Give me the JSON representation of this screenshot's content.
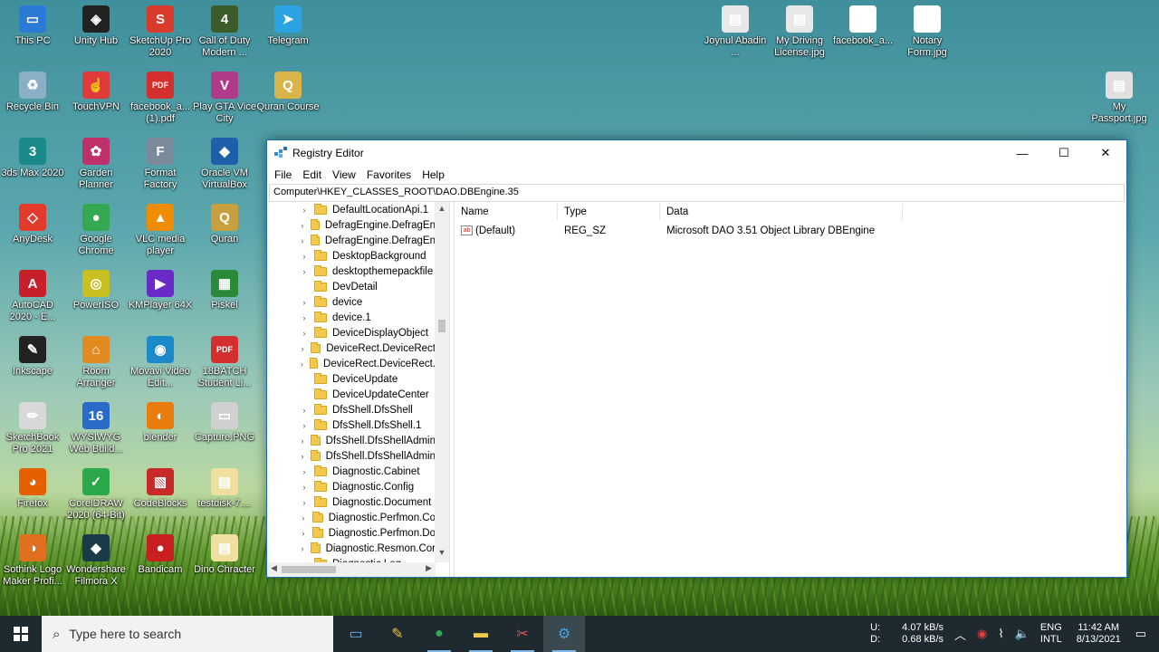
{
  "desktop_icons": [
    {
      "label": "This PC",
      "color": "#2b7bd6",
      "glyph": "▭"
    },
    {
      "label": "Unity Hub",
      "color": "#222222",
      "glyph": "◈"
    },
    {
      "label": "SketchUp Pro 2020",
      "color": "#d83b2b",
      "glyph": "S"
    },
    {
      "label": "Call of Duty Modern ...",
      "color": "#3b5b2b",
      "glyph": "4"
    },
    {
      "label": "Telegram",
      "color": "#2aa3e0",
      "glyph": "➤"
    },
    {
      "label": "Recycle Bin",
      "color": "#8ab0c8",
      "glyph": "♻"
    },
    {
      "label": "TouchVPN",
      "color": "#e03a3a",
      "glyph": "☝"
    },
    {
      "label": "facebook_a... (1).pdf",
      "color": "#d32f2f",
      "glyph": "PDF"
    },
    {
      "label": "Play GTA Vice City",
      "color": "#b03a8a",
      "glyph": "V"
    },
    {
      "label": "Quran Course",
      "color": "#d9b44a",
      "glyph": "Q"
    },
    {
      "label": "3ds Max 2020",
      "color": "#1a8a8a",
      "glyph": "3"
    },
    {
      "label": "Garden Planner",
      "color": "#c0306a",
      "glyph": "✿"
    },
    {
      "label": "Format Factory",
      "color": "#7a8a9a",
      "glyph": "F"
    },
    {
      "label": "Oracle VM VirtualBox",
      "color": "#1d5fa8",
      "glyph": "◆"
    },
    {
      "label": "AnyDesk",
      "color": "#e23b2e",
      "glyph": "◇"
    },
    {
      "label": "Google Chrome",
      "color": "#34a853",
      "glyph": "●"
    },
    {
      "label": "VLC media player",
      "color": "#f08c00",
      "glyph": "▲"
    },
    {
      "label": "Quran",
      "color": "#c8a040",
      "glyph": "Q"
    },
    {
      "label": "AutoCAD 2020 - E...",
      "color": "#c8202a",
      "glyph": "A"
    },
    {
      "label": "PowerISO",
      "color": "#c8c020",
      "glyph": "◎"
    },
    {
      "label": "KMPlayer 64X",
      "color": "#6a2ac8",
      "glyph": "▶"
    },
    {
      "label": "Piskel",
      "color": "#2a8a3a",
      "glyph": "▦"
    },
    {
      "label": "Inkscape",
      "color": "#222222",
      "glyph": "✎"
    },
    {
      "label": "Room Arranger",
      "color": "#e08a20",
      "glyph": "⌂"
    },
    {
      "label": "Movavi Video Edit...",
      "color": "#1a8ac8",
      "glyph": "◉"
    },
    {
      "label": "18BATCH Student Li...",
      "color": "#d32f2f",
      "glyph": "PDF"
    },
    {
      "label": "SketchBook Pro 2021",
      "color": "#d8d8d8",
      "glyph": "✏"
    },
    {
      "label": "WYSIWYG Web Build...",
      "color": "#2a6ac8",
      "glyph": "16"
    },
    {
      "label": "blender",
      "color": "#e87d0d",
      "glyph": "◐"
    },
    {
      "label": "Capture.PNG",
      "color": "#d0d0d0",
      "glyph": "▭"
    },
    {
      "label": "Firefox",
      "color": "#e66000",
      "glyph": "◕"
    },
    {
      "label": "CorelDRAW 2020 (64-Bit)",
      "color": "#2ba84a",
      "glyph": "✓"
    },
    {
      "label": "CodeBlocks",
      "color": "#c82a2a",
      "glyph": "▧"
    },
    {
      "label": "testdisk-7....",
      "color": "#f0e0a0",
      "glyph": "▤"
    },
    {
      "label": "Sothink Logo Maker Profi...",
      "color": "#e07020",
      "glyph": "◑"
    },
    {
      "label": "Wondershare Filmora X",
      "color": "#1a3a4a",
      "glyph": "◆"
    },
    {
      "label": "Bandicam",
      "color": "#c82020",
      "glyph": "●"
    },
    {
      "label": "Dino Chracter",
      "color": "#f0e0a0",
      "glyph": "▤"
    },
    {
      "label": "Joynul Abadin ...",
      "color": "#e8e8e8",
      "glyph": "▤"
    },
    {
      "label": "My Driving License.jpg",
      "color": "#e8e8e8",
      "glyph": "▤"
    },
    {
      "label": "facebook_a...",
      "color": "#ffffff",
      "glyph": "▢"
    },
    {
      "label": "Notary Form.jpg",
      "color": "#ffffff",
      "glyph": "▤"
    },
    {
      "label": "My Passport.jpg",
      "color": "#e0e0e0",
      "glyph": "▤"
    }
  ],
  "window": {
    "title": "Registry Editor",
    "minimize": "—",
    "maximize": "☐",
    "close": "✕",
    "menu": [
      "File",
      "Edit",
      "View",
      "Favorites",
      "Help"
    ],
    "address": "Computer\\HKEY_CLASSES_ROOT\\DAO.DBEngine.35"
  },
  "tree_items": [
    {
      "label": "DefaultLocationApi.1",
      "expandable": true
    },
    {
      "label": "DefragEngine.DefragEn",
      "expandable": true
    },
    {
      "label": "DefragEngine.DefragEn",
      "expandable": true
    },
    {
      "label": "DesktopBackground",
      "expandable": true
    },
    {
      "label": "desktopthemepackfile",
      "expandable": true
    },
    {
      "label": "DevDetail",
      "expandable": false
    },
    {
      "label": "device",
      "expandable": true
    },
    {
      "label": "device.1",
      "expandable": true
    },
    {
      "label": "DeviceDisplayObject",
      "expandable": true
    },
    {
      "label": "DeviceRect.DeviceRect",
      "expandable": true
    },
    {
      "label": "DeviceRect.DeviceRect.",
      "expandable": true
    },
    {
      "label": "DeviceUpdate",
      "expandable": false
    },
    {
      "label": "DeviceUpdateCenter",
      "expandable": false
    },
    {
      "label": "DfsShell.DfsShell",
      "expandable": true
    },
    {
      "label": "DfsShell.DfsShell.1",
      "expandable": true
    },
    {
      "label": "DfsShell.DfsShellAdmin",
      "expandable": true
    },
    {
      "label": "DfsShell.DfsShellAdmin",
      "expandable": true
    },
    {
      "label": "Diagnostic.Cabinet",
      "expandable": true
    },
    {
      "label": "Diagnostic.Config",
      "expandable": true
    },
    {
      "label": "Diagnostic.Document",
      "expandable": true
    },
    {
      "label": "Diagnostic.Perfmon.Co",
      "expandable": true
    },
    {
      "label": "Diagnostic.Perfmon.Do",
      "expandable": true
    },
    {
      "label": "Diagnostic.Resmon.Cor",
      "expandable": true
    },
    {
      "label": "Diagnostic.Log",
      "expandable": true
    }
  ],
  "values_pane": {
    "headers": [
      "Name",
      "Type",
      "Data"
    ],
    "rows": [
      {
        "name": "(Default)",
        "type": "REG_SZ",
        "data": "Microsoft DAO 3.51 Object Library DBEngine",
        "icon": "ab"
      }
    ]
  },
  "taskbar": {
    "search_placeholder": "Type here to search",
    "apps": [
      {
        "name": "explorer-app",
        "glyph": "▭",
        "color": "#6ab0e6"
      },
      {
        "name": "paint-app",
        "glyph": "✎",
        "color": "#f0c040"
      },
      {
        "name": "chrome-app",
        "glyph": "●",
        "color": "#34a853"
      },
      {
        "name": "file-explorer-app",
        "glyph": "▬",
        "color": "#f3c94c"
      },
      {
        "name": "snipping-app",
        "glyph": "✂",
        "color": "#e05050"
      },
      {
        "name": "registry-editor-app",
        "glyph": "⚙",
        "color": "#4aa0e0"
      }
    ],
    "drives": "U:\nD:",
    "drive_u": "U:",
    "drive_d": "D:",
    "net_up": "4.07 kB/s",
    "net_down": "0.68 kB/s",
    "lang_top": "ENG",
    "lang_bottom": "INTL",
    "time": "11:42 AM",
    "date": "8/13/2021"
  }
}
